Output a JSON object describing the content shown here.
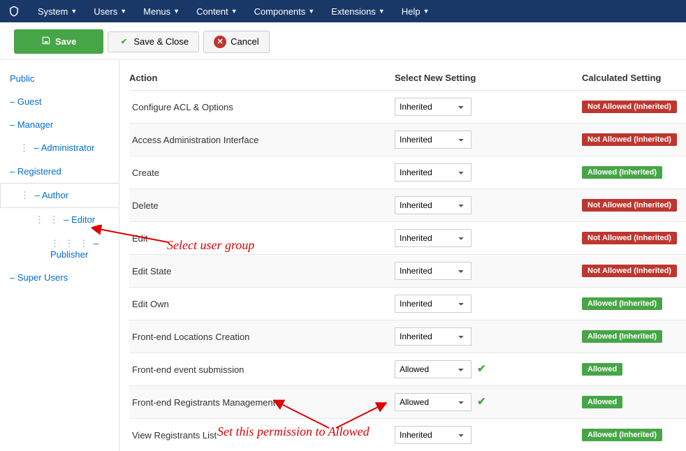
{
  "navbar": {
    "items": [
      "System",
      "Users",
      "Menus",
      "Content",
      "Components",
      "Extensions",
      "Help"
    ]
  },
  "toolbar": {
    "save": "Save",
    "save_close": "Save & Close",
    "cancel": "Cancel"
  },
  "sidebar": {
    "groups": [
      {
        "label": "Public",
        "indent": 0,
        "prefix": ""
      },
      {
        "label": "Guest",
        "indent": 0,
        "prefix": "– "
      },
      {
        "label": "Manager",
        "indent": 0,
        "prefix": "– "
      },
      {
        "label": "Administrator",
        "indent": 1,
        "prefix": "– "
      },
      {
        "label": "Registered",
        "indent": 0,
        "prefix": "– "
      },
      {
        "label": "Author",
        "indent": 1,
        "prefix": "– ",
        "active": true
      },
      {
        "label": "Editor",
        "indent": 2,
        "prefix": "– "
      },
      {
        "label": "Publisher",
        "indent": 3,
        "prefix": "– "
      },
      {
        "label": "Super Users",
        "indent": 0,
        "prefix": "– "
      }
    ]
  },
  "headers": {
    "action": "Action",
    "setting": "Select New Setting",
    "calc": "Calculated Setting"
  },
  "permissions": [
    {
      "action": "Configure ACL & Options",
      "setting": "Inherited",
      "check": false,
      "calc": "Not Allowed (Inherited)",
      "calc_color": "red"
    },
    {
      "action": "Access Administration Interface",
      "setting": "Inherited",
      "check": false,
      "calc": "Not Allowed (Inherited)",
      "calc_color": "red"
    },
    {
      "action": "Create",
      "setting": "Inherited",
      "check": false,
      "calc": "Allowed (Inherited)",
      "calc_color": "green"
    },
    {
      "action": "Delete",
      "setting": "Inherited",
      "check": false,
      "calc": "Not Allowed (Inherited)",
      "calc_color": "red"
    },
    {
      "action": "Edit",
      "setting": "Inherited",
      "check": false,
      "calc": "Not Allowed (Inherited)",
      "calc_color": "red"
    },
    {
      "action": "Edit State",
      "setting": "Inherited",
      "check": false,
      "calc": "Not Allowed (Inherited)",
      "calc_color": "red"
    },
    {
      "action": "Edit Own",
      "setting": "Inherited",
      "check": false,
      "calc": "Allowed (Inherited)",
      "calc_color": "green"
    },
    {
      "action": "Front-end Locations Creation",
      "setting": "Inherited",
      "check": false,
      "calc": "Allowed (Inherited)",
      "calc_color": "green"
    },
    {
      "action": "Front-end event submission",
      "setting": "Allowed",
      "check": true,
      "calc": "Allowed",
      "calc_color": "green"
    },
    {
      "action": "Front-end Registrants Management",
      "setting": "Allowed",
      "check": true,
      "calc": "Allowed",
      "calc_color": "green"
    },
    {
      "action": "View Registrants List",
      "setting": "Inherited",
      "check": false,
      "calc": "Allowed (Inherited)",
      "calc_color": "green"
    }
  ],
  "annotations": {
    "select_group": "Select user group",
    "set_perm": "Set this permission to Allowed"
  }
}
